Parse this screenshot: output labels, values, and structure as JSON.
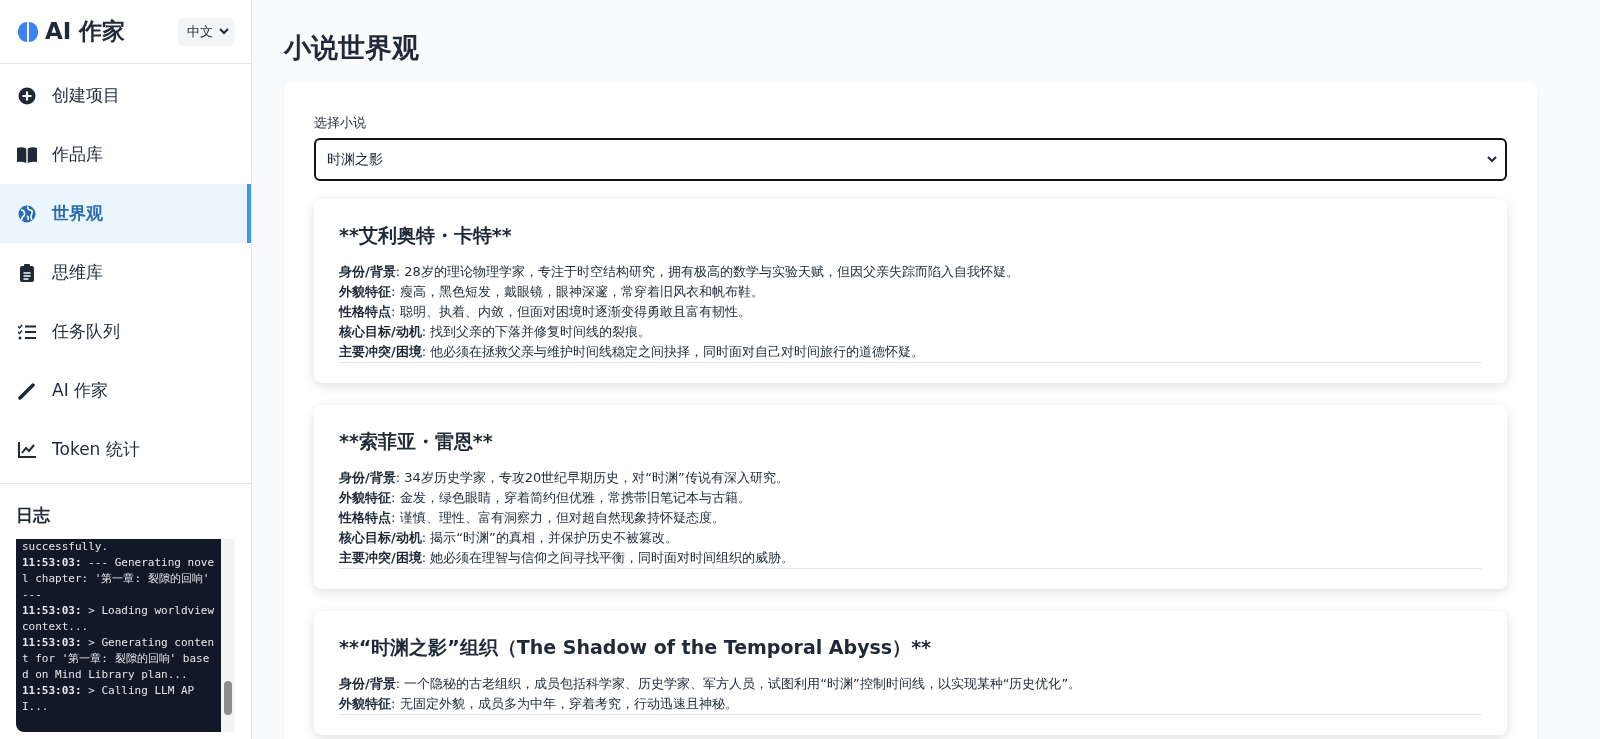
{
  "sidebar": {
    "logo_text": "AI 作家",
    "language": {
      "value": "中文"
    },
    "nav_items": [
      {
        "kind": "create",
        "label": "创建项目",
        "selected": false
      },
      {
        "kind": "library",
        "label": "作品库",
        "selected": false
      },
      {
        "kind": "world",
        "label": "世界观",
        "selected": true
      },
      {
        "kind": "mind",
        "label": "思维库",
        "selected": false
      },
      {
        "kind": "tasks",
        "label": "任务队列",
        "selected": false
      },
      {
        "kind": "writer",
        "label": "AI 作家",
        "selected": false
      },
      {
        "kind": "tokens",
        "label": "Token 统计",
        "selected": false
      }
    ],
    "log": {
      "title": "日志",
      "entries": [
        {
          "text": "successfully."
        },
        {
          "time": "11:53:03:",
          "text": "--- Generating novel chapter: '第一章: 裂隙的回响' ---"
        },
        {
          "time": "11:53:03:",
          "text": "> Loading worldview context..."
        },
        {
          "time": "11:53:03:",
          "text": "> Generating content for '第一章: 裂隙的回响' based on Mind Library plan..."
        },
        {
          "time": "11:53:03:",
          "text": "> Calling LLM API..."
        }
      ]
    }
  },
  "main": {
    "title": "小说世界观",
    "novel_select": {
      "label": "选择小说",
      "value": "时渊之影"
    },
    "characters": [
      {
        "name": "**艾利奥特・卡特**",
        "lines": [
          "**身份/背景**: 28岁的理论物理学家，专注于时空结构研究，拥有极高的数学与实验天赋，但因父亲失踪而陷入自我怀疑。",
          "**外貌特征**: 瘦高，黑色短发，戴眼镜，眼神深邃，常穿着旧风衣和帆布鞋。",
          "**性格特点**: 聪明、执着、内敛，但面对困境时逐渐变得勇敢且富有韧性。",
          "**核心目标/动机**: 找到父亲的下落并修复时间线的裂痕。",
          "**主要冲突/困境**: 他必须在拯救父亲与维护时间线稳定之间抉择，同时面对自己对时间旅行的道德怀疑。"
        ]
      },
      {
        "name": "**索菲亚・雷恩**",
        "lines": [
          "**身份/背景**: 34岁历史学家，专攻20世纪早期历史，对“时渊”传说有深入研究。",
          "**外貌特征**: 金发，绿色眼睛，穿着简约但优雅，常携带旧笔记本与古籍。",
          "**性格特点**: 谨慎、理性、富有洞察力，但对超自然现象持怀疑态度。",
          "**核心目标/动机**: 揭示“时渊”的真相，并保护历史不被篡改。",
          "**主要冲突/困境**: 她必须在理智与信仰之间寻找平衡，同时面对时间组织的威胁。"
        ]
      },
      {
        "name": "**“时渊之影”组织（The Shadow of the Temporal Abyss）**",
        "lines": [
          "**身份/背景**: 一个隐秘的古老组织，成员包括科学家、历史学家、军方人员，试图利用“时渊”控制时间线，以实现某种“历史优化”。",
          "**外貌特征**: 无固定外貌，成员多为中年，穿着考究，行动迅速且神秘。"
        ]
      }
    ]
  }
}
